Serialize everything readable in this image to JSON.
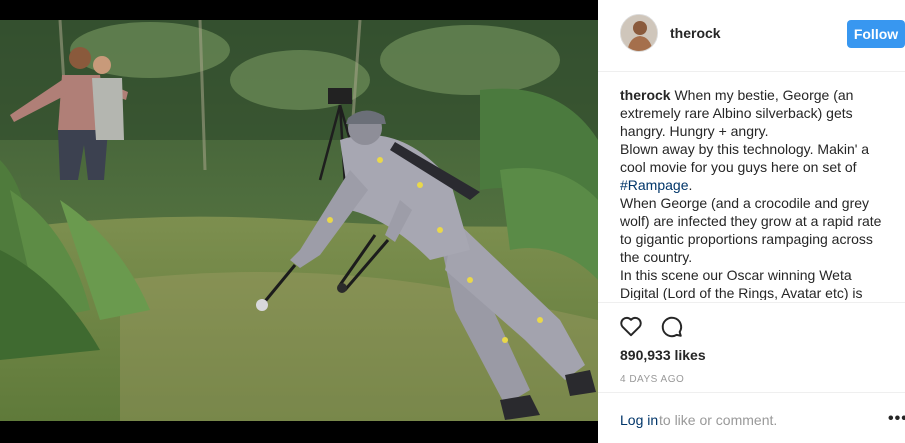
{
  "post": {
    "username": "therock",
    "follow_label": "Follow",
    "caption": {
      "username": "therock",
      "line1": " When my bestie, George (an extremely rare Albino silverback) gets hangry. Hungry + angry.",
      "line2": "Blown away by this technology. Makin' a cool movie for you guys here on set of",
      "hashtag": "#Rampage",
      "line3": ".",
      "line4": "When George (and a crocodile and grey wolf) are infected they grow at a rapid rate to gigantic proportions rampaging across the country.",
      "line5": "In this scene our Oscar winning Weta Digital (Lord of the Rings, Avatar etc) is"
    },
    "likes": "890,933 likes",
    "time": "4 DAYS AGO",
    "login_link": "Log in",
    "login_rest": " to like or comment.",
    "more_label": "•••",
    "icons": {
      "like": "heart-icon",
      "comment": "comment-icon",
      "more": "more-options-icon"
    },
    "colors": {
      "follow_bg": "#3897f0",
      "link": "#003569",
      "muted": "#999999"
    }
  }
}
